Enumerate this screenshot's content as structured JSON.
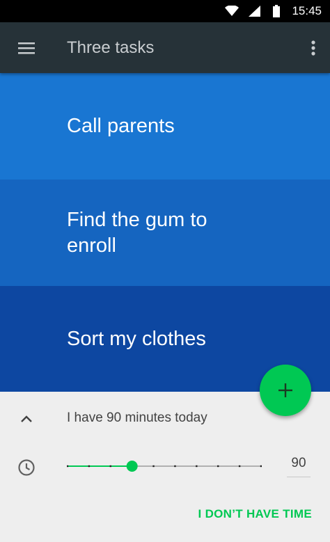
{
  "status_bar": {
    "time": "15:45",
    "icons": [
      "wifi-icon",
      "cell-signal-icon",
      "battery-icon"
    ]
  },
  "app_bar": {
    "title": "Three tasks",
    "menu_icon": "hamburger-menu-icon",
    "overflow_icon": "more-vertical-icon"
  },
  "tasks": [
    {
      "label": "Call parents",
      "color": "#1976d2"
    },
    {
      "label": "Find the gum to enroll",
      "color": "#1565c0"
    },
    {
      "label": "Sort my clothes",
      "color": "#0d47a1"
    }
  ],
  "fab": {
    "icon": "plus-icon",
    "color": "#00c853"
  },
  "time_panel": {
    "summary": "I have 90 minutes today",
    "collapse_icon": "chevron-up-icon",
    "clock_icon": "clock-icon",
    "slider": {
      "min": 0,
      "max": 270,
      "step": 30,
      "value": 90
    },
    "value_display": "90",
    "no_time_label": "I DON’T HAVE TIME"
  },
  "colors": {
    "accent": "#00c853",
    "app_bar": "#263238",
    "panel": "#eeeeee"
  }
}
